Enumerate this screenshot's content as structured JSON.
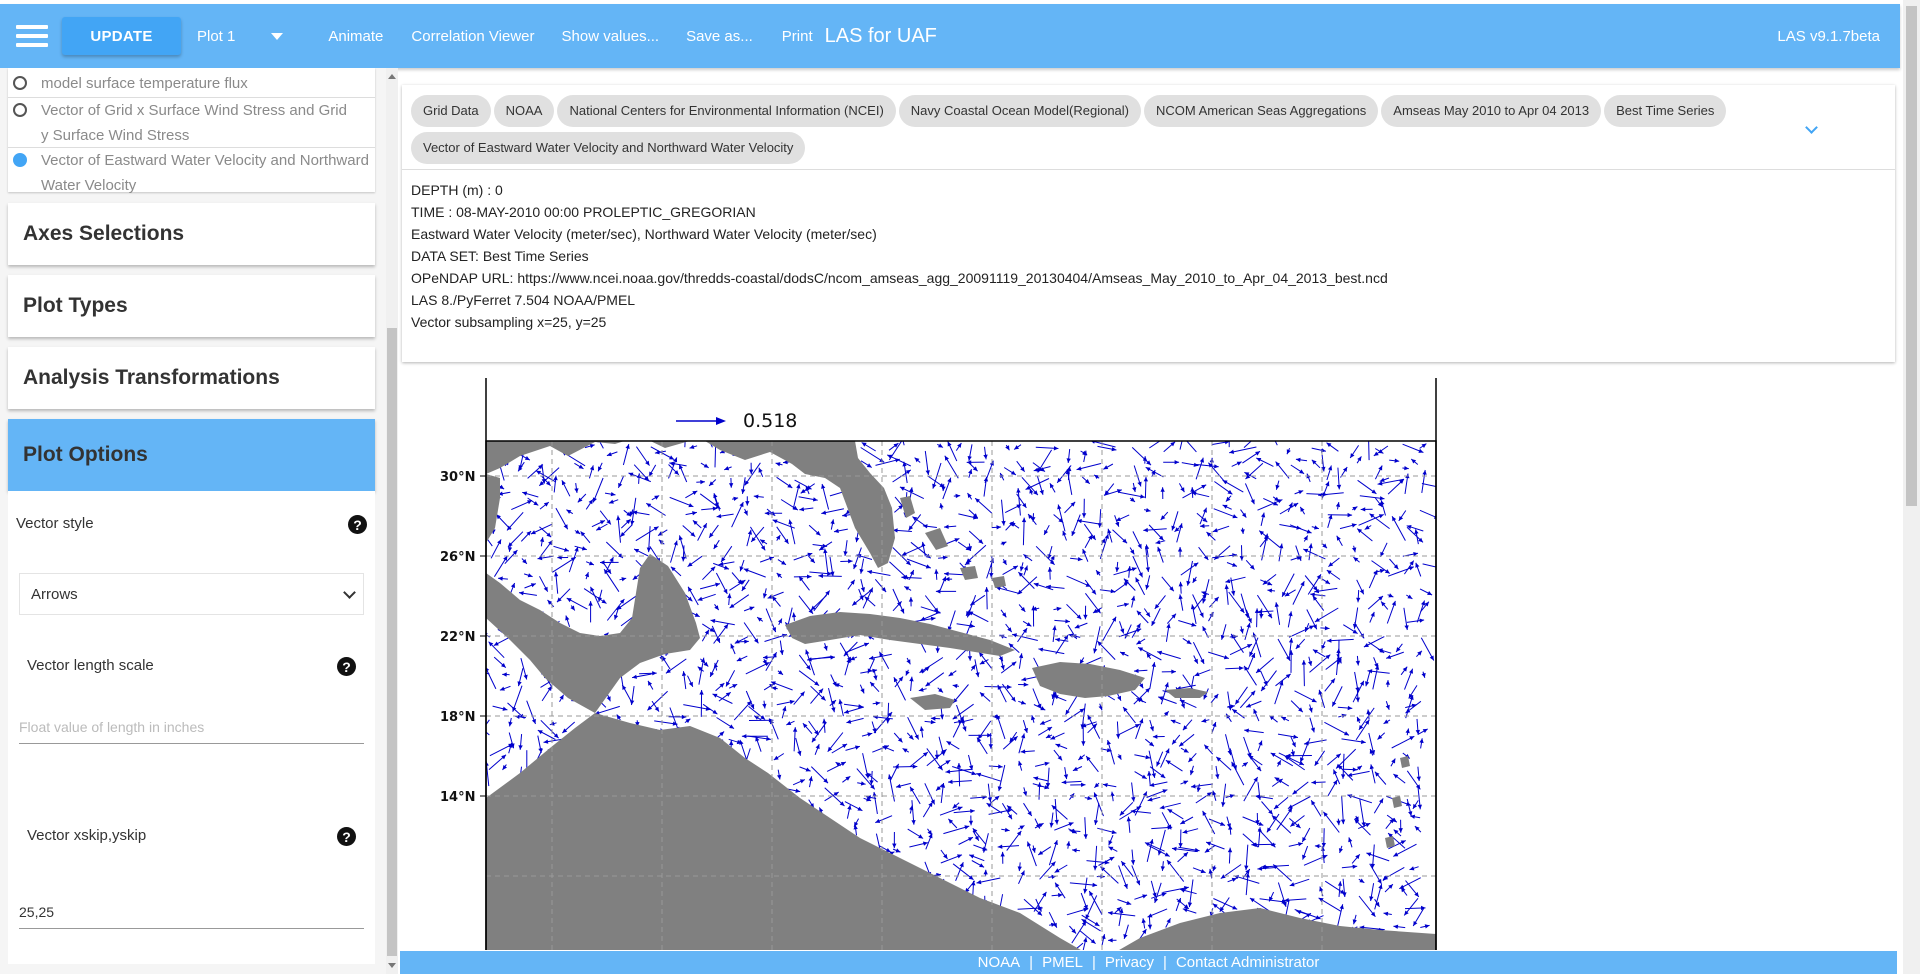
{
  "topbar": {
    "update_label": "UPDATE",
    "plot_label": "Plot 1",
    "animate": "Animate",
    "correlation": "Correlation Viewer",
    "show_values": "Show values...",
    "save_as": "Save as...",
    "print": "Print",
    "app_title": "LAS for UAF",
    "version": "LAS v9.1.7beta"
  },
  "variables": [
    {
      "label": "model surface temperature flux",
      "selected": false
    },
    {
      "label": "Vector of Grid x Surface Wind Stress and Grid y Surface Wind Stress",
      "selected": false
    },
    {
      "label": "Vector of Eastward Water Velocity and Northward Water Velocity",
      "selected": true
    }
  ],
  "sections": {
    "axes": "Axes Selections",
    "plot_types": "Plot Types",
    "analysis": "Analysis Transformations",
    "plot_options": "Plot Options"
  },
  "options": {
    "vector_style_label": "Vector style",
    "vector_style_value": "Arrows",
    "length_scale_label": "Vector length scale",
    "length_scale_placeholder": "Float value of length in inches",
    "skip_label": "Vector xskip,yskip",
    "skip_value": "25,25",
    "help_glyph": "?"
  },
  "breadcrumbs": [
    "Grid Data",
    "NOAA",
    "National Centers for Environmental Information (NCEI)",
    "Navy Coastal Ocean Model(Regional)",
    "NCOM American Seas Aggregations",
    "Amseas May 2010 to Apr 04 2013",
    "Best Time Series",
    "Vector of Eastward Water Velocity and Northward Water Velocity"
  ],
  "info": {
    "depth": "DEPTH (m) : 0",
    "time": "TIME : 08-MAY-2010 00:00 PROLEPTIC_GREGORIAN",
    "variables": "Eastward Water Velocity (meter/sec), Northward Water Velocity (meter/sec)",
    "dataset": "DATA SET: Best Time Series",
    "opendap": "OPeNDAP URL: https://www.ncei.noaa.gov/thredds-coastal/dodsC/ncom_amseas_agg_20091119_20130404/Amseas_May_2010_to_Apr_04_2013_best.ncd",
    "software": "LAS 8./PyFerret 7.504 NOAA/PMEL",
    "subsampling": "Vector subsampling x=25, y=25"
  },
  "plot": {
    "reference_value": "0.518",
    "lat_ticks": [
      "30°N",
      "26°N",
      "22°N",
      "18°N",
      "14°N"
    ],
    "arrow_color": "#0000cc",
    "land_color": "#808080"
  },
  "footer": {
    "links": [
      "NOAA",
      "PMEL",
      "Privacy",
      "Contact Administrator"
    ]
  },
  "colors": {
    "primary": "#64b5f6",
    "accent": "#42a5f5"
  }
}
